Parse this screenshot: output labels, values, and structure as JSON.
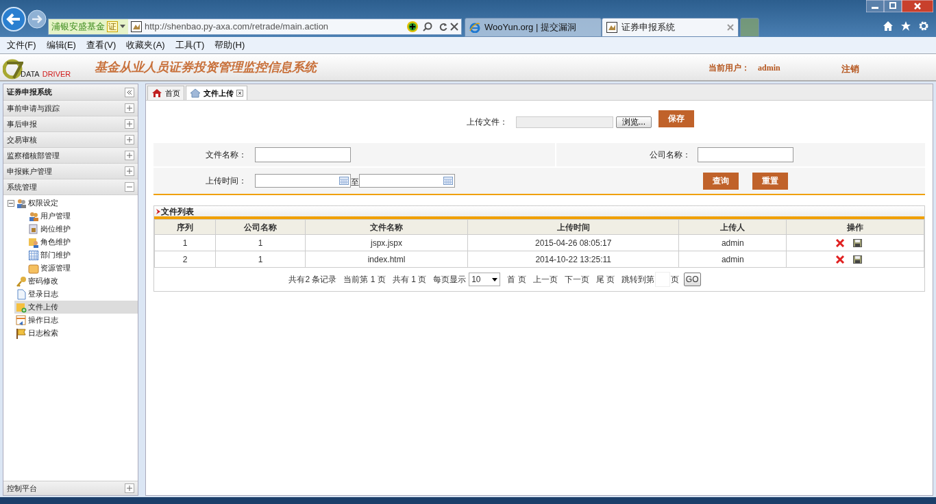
{
  "browser": {
    "favorites_site": "浦银安盛基金",
    "cert_badge": "证",
    "url": "http://shenbao.py-axa.com/retrade/main.action",
    "tabs": [
      {
        "title": "WooYun.org | 提交漏洞",
        "selected": false
      },
      {
        "title": "证券申报系统",
        "selected": true
      }
    ]
  },
  "menu_bar": [
    "文件(F)",
    "编辑(E)",
    "查看(V)",
    "收藏夹(A)",
    "工具(T)",
    "帮助(H)"
  ],
  "app_header": {
    "logo_word_1": "DATA",
    "logo_word_2": "DRIVER",
    "title": "基金从业人员证券投资管理监控信息系统",
    "user_label": "当前用户：",
    "user": "admin",
    "logout": "注销"
  },
  "sidebar": {
    "title": "证券申报系统",
    "sections": [
      {
        "label": "事前申请与跟踪",
        "expanded": false
      },
      {
        "label": "事后申报",
        "expanded": false
      },
      {
        "label": "交易审核",
        "expanded": false
      },
      {
        "label": "监察稽核部管理",
        "expanded": false
      },
      {
        "label": "申报账户管理",
        "expanded": false
      },
      {
        "label": "系统管理",
        "expanded": true,
        "children": [
          {
            "label": "权限设定",
            "expanded": true,
            "selected": false,
            "children": [
              {
                "label": "用户管理",
                "selected": false
              },
              {
                "label": "岗位维护",
                "selected": false
              },
              {
                "label": "角色维护",
                "selected": false
              },
              {
                "label": "部门维护",
                "selected": false
              },
              {
                "label": "资源管理",
                "selected": false
              }
            ]
          },
          {
            "label": "密码修改",
            "selected": false
          },
          {
            "label": "登录日志",
            "selected": false
          },
          {
            "label": "文件上传",
            "selected": true
          },
          {
            "label": "操作日志",
            "selected": false
          },
          {
            "label": "日志检索",
            "selected": false
          }
        ]
      }
    ],
    "footer": {
      "label": "控制平台",
      "expanded": false
    }
  },
  "content_tabs": [
    {
      "label": "首页",
      "selected": false
    },
    {
      "label": "文件上传",
      "selected": true
    }
  ],
  "upload": {
    "label": "上传文件：",
    "browse_button": "浏览...",
    "save_button": "保存"
  },
  "search": {
    "file_name_label": "文件名称：",
    "company_label": "公司名称：",
    "time_label": "上传时间：",
    "range_separator": "至",
    "query_button": "查询",
    "reset_button": "重置"
  },
  "file_list": {
    "title": "文件列表",
    "columns": [
      "序列",
      "公司名称",
      "文件名称",
      "上传时间",
      "上传人",
      "操作"
    ],
    "rows": [
      [
        "1",
        "1",
        "jspx.jspx",
        "2015-04-26 08:05:17",
        "admin"
      ],
      [
        "2",
        "1",
        "index.html",
        "2014-10-22 13:25:11",
        "admin"
      ]
    ]
  },
  "pager": {
    "total_records": "共有2 条记录",
    "current_page": "当前第 1 页",
    "total_pages": "共有 1 页",
    "per_page_label": "每页显示",
    "per_page": "10",
    "first": "首 页",
    "prev": "上一页",
    "next": "下一页",
    "last": "尾 页",
    "jump_label": "跳转到第",
    "jump_suffix": "页",
    "go_button": "GO"
  }
}
